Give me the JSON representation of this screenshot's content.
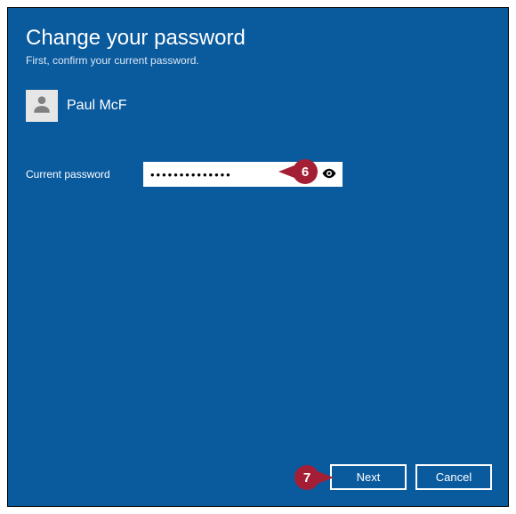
{
  "dialog": {
    "title": "Change your password",
    "subtitle": "First, confirm your current password."
  },
  "user": {
    "name": "Paul McF"
  },
  "field": {
    "label": "Current password",
    "value": "••••••••••••••"
  },
  "buttons": {
    "next": "Next",
    "cancel": "Cancel"
  },
  "callouts": {
    "six": "6",
    "seven": "7"
  },
  "colors": {
    "background": "#0a5a9e",
    "callout": "#a41e36"
  }
}
